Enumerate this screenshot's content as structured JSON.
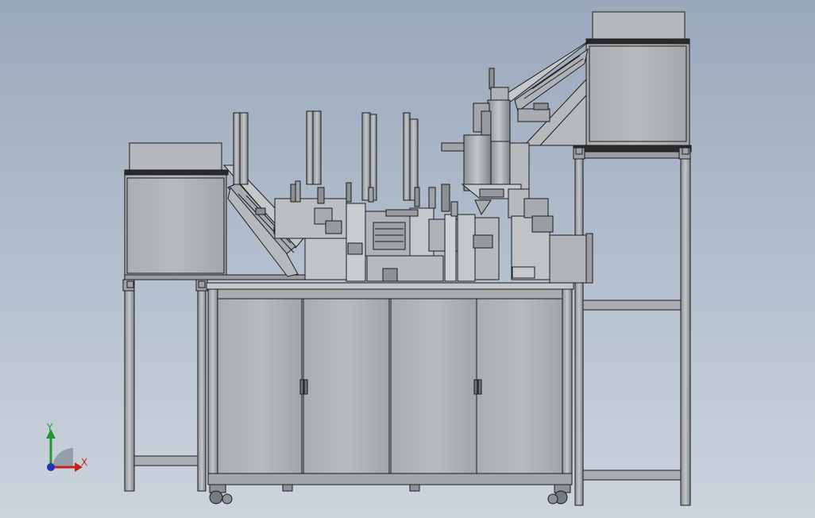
{
  "viewport": {
    "background_top": "#9aa8bc",
    "background_bottom": "#ccd4dd"
  },
  "model": {
    "description_icon": "assembly-machine-model",
    "metal_color": "#b9bcc0",
    "metal_dark": "#8e9296",
    "edge_color": "#1c1c1c"
  },
  "triad": {
    "x_label": "X",
    "y_label": "Y",
    "x_color": "#c81e1e",
    "y_color": "#1e9a2e",
    "origin_color": "#2233bb"
  }
}
